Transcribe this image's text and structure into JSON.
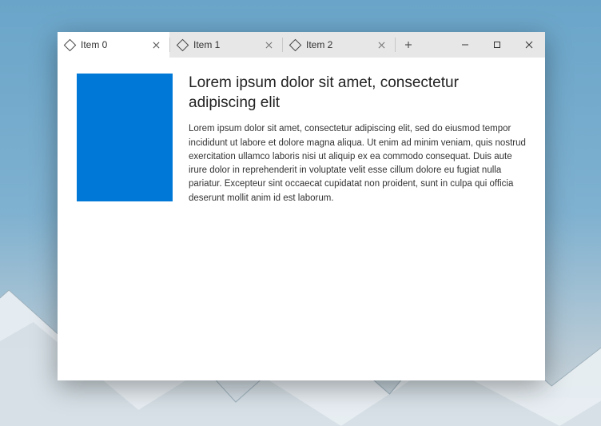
{
  "tabs": [
    {
      "label": "Item 0",
      "active": true
    },
    {
      "label": "Item 1",
      "active": false
    },
    {
      "label": "Item 2",
      "active": false
    }
  ],
  "content": {
    "heading": "Lorem ipsum dolor sit amet, consectetur adipiscing elit",
    "body": "Lorem ipsum dolor sit amet, consectetur adipiscing elit, sed do eiusmod tempor incididunt ut labore et dolore magna aliqua. Ut enim ad minim veniam, quis nostrud exercitation ullamco laboris nisi ut aliquip ex ea commodo consequat. Duis aute irure dolor in reprehenderit in voluptate velit esse cillum dolore eu fugiat nulla pariatur. Excepteur sint occaecat cupidatat non proident, sunt in culpa qui officia deserunt mollit anim id est laborum.",
    "accent_color": "#0078d7"
  }
}
